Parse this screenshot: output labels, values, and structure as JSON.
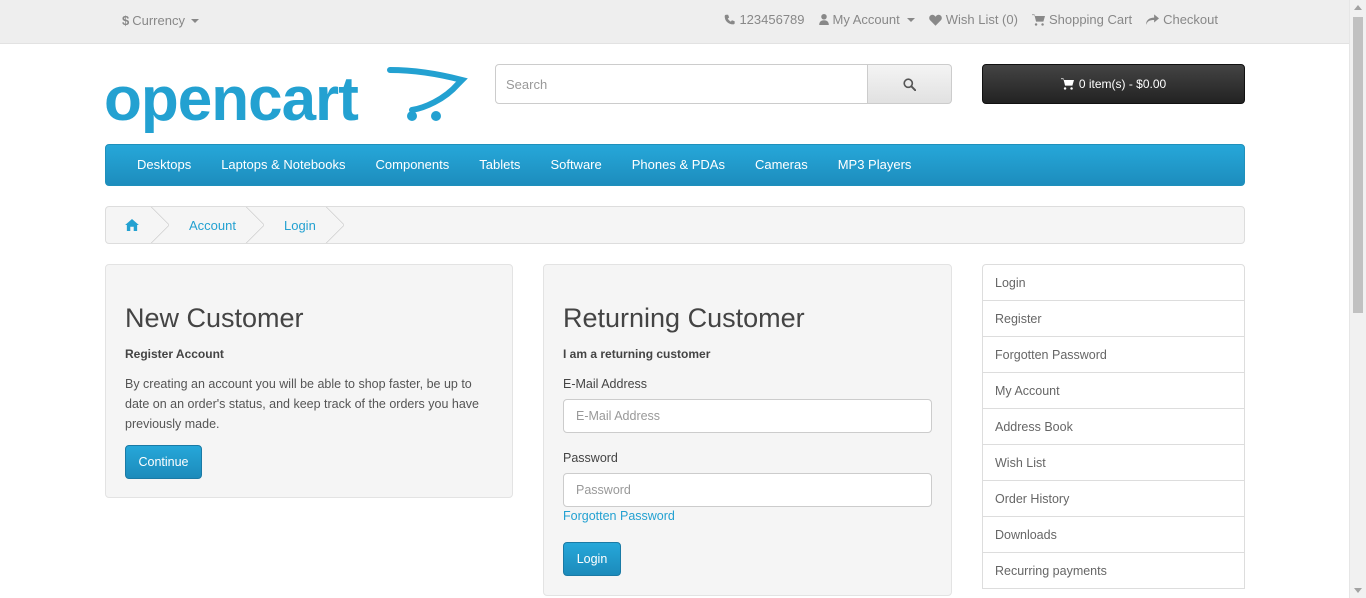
{
  "topbar": {
    "currency": {
      "symbol": "$",
      "label": "Currency"
    },
    "phone": "123456789",
    "my_account": "My Account",
    "wishlist": "Wish List (0)",
    "shopping_cart": "Shopping Cart",
    "checkout": "Checkout"
  },
  "header": {
    "logo_text": "opencart",
    "search_placeholder": "Search",
    "cart_label": "0 item(s) - $0.00"
  },
  "menu": {
    "items": [
      "Desktops",
      "Laptops & Notebooks",
      "Components",
      "Tablets",
      "Software",
      "Phones & PDAs",
      "Cameras",
      "MP3 Players"
    ]
  },
  "breadcrumb": {
    "items": [
      "Account",
      "Login"
    ]
  },
  "new_customer": {
    "title": "New Customer",
    "subtitle": "Register Account",
    "text": "By creating an account you will be able to shop faster, be up to date on an order's status, and keep track of the orders you have previously made.",
    "button": "Continue"
  },
  "returning_customer": {
    "title": "Returning Customer",
    "subtitle": "I am a returning customer",
    "email_label": "E-Mail Address",
    "email_placeholder": "E-Mail Address",
    "password_label": "Password",
    "password_placeholder": "Password",
    "forgotten_link": "Forgotten Password",
    "button": "Login"
  },
  "sidebar": {
    "items": [
      "Login",
      "Register",
      "Forgotten Password",
      "My Account",
      "Address Book",
      "Wish List",
      "Order History",
      "Downloads",
      "Recurring payments"
    ]
  },
  "colors": {
    "accent": "#23a1d1",
    "cart_bg": "#222222"
  }
}
